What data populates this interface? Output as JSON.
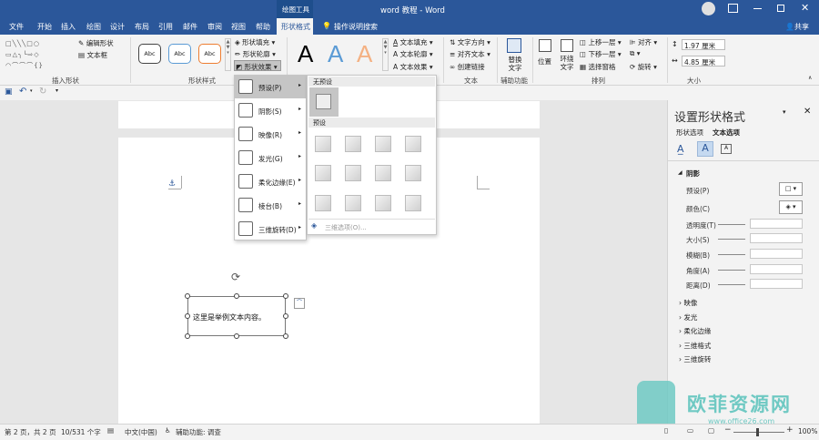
{
  "titlebar": {
    "context_tab": "绘图工具",
    "title": "word 教程 - Word"
  },
  "tabs": [
    "文件",
    "开始",
    "插入",
    "绘图",
    "设计",
    "布局",
    "引用",
    "邮件",
    "审阅",
    "视图",
    "帮助",
    "形状格式"
  ],
  "tell_me": "操作说明搜索",
  "share": "共享",
  "ribbon": {
    "insert_shapes": {
      "label": "插入形状",
      "edit_shape": "编辑形状",
      "text_box": "文本框"
    },
    "shape_styles": {
      "label": "形状样式",
      "samples": [
        "Abc",
        "Abc",
        "Abc"
      ],
      "fill": "形状填充",
      "outline": "形状轮廓",
      "effects": "形状效果"
    },
    "wordart": {
      "samples": [
        "A",
        "A",
        "A"
      ],
      "text_fill": "文本填充",
      "text_outline": "文本轮廓",
      "text_effects": "文本效果"
    },
    "text": {
      "label": "文本",
      "direction": "文字方向",
      "align": "对齐文本",
      "link": "创建链接"
    },
    "accessibility": {
      "label": "辅助功能",
      "alt_text": "替换文字"
    },
    "arrange": {
      "label": "排列",
      "position": "位置",
      "wrap": "环绕文字",
      "forward": "上移一层",
      "backward": "下移一层",
      "pane": "选择窗格",
      "align": "对齐",
      "rotate": "旋转"
    },
    "size": {
      "label": "大小",
      "height": "1.97 厘米",
      "width": "4.85 厘米"
    }
  },
  "effects_menu": {
    "items": [
      "预设(P)",
      "阴影(S)",
      "映像(R)",
      "发光(G)",
      "柔化边缘(E)",
      "棱台(B)",
      "三维旋转(D)"
    ]
  },
  "preset_gallery": {
    "no_preset": "无预设",
    "preset": "预设",
    "more": "三维选项(O)..."
  },
  "textbox": {
    "text": "这里是举例文本内容。"
  },
  "pane": {
    "title": "设置形状格式",
    "tab_shape": "形状选项",
    "tab_text": "文本选项",
    "section": "阴影",
    "preset": "预设(P)",
    "color": "颜色(C)",
    "props": [
      "透明度(T)",
      "大小(S)",
      "模糊(B)",
      "角度(A)",
      "距离(D)"
    ],
    "collapsed": [
      "映像",
      "发光",
      "柔化边缘",
      "三维格式",
      "三维旋转"
    ]
  },
  "status": {
    "page": "第 2 页，共 2 页",
    "words": "10/531 个字",
    "lang": "中文(中国)",
    "access": "辅助功能: 调查",
    "zoom": "100%"
  },
  "watermark": {
    "name": "欧菲资源网",
    "url": "www.office26.com"
  },
  "colors": {
    "accent": "#2b579a",
    "context_tab": "#1e4e8c"
  }
}
